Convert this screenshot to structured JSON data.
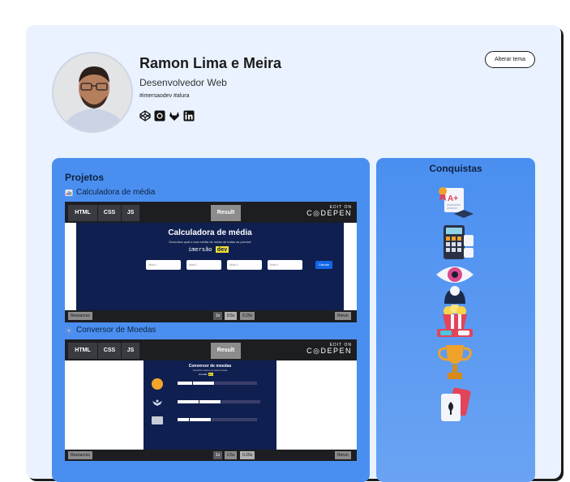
{
  "profile": {
    "name": "Ramon Lima e Meira",
    "role": "Desenvolvedor Web",
    "tags": "#imersaodev #alura",
    "social_icons": [
      "codepen-icon",
      "github-icon",
      "gitlab-icon",
      "linkedin-icon"
    ]
  },
  "theme_button": {
    "label": "Alterar tema"
  },
  "projects": {
    "title": "Projetos",
    "items": [
      {
        "label": "Calculadora de média",
        "icon": "stats-icon",
        "embed": {
          "tabs": [
            "HTML",
            "CSS",
            "JS"
          ],
          "result_tab": "Result",
          "edit_on": "EDIT ON",
          "codepen": "C◎DEPEN",
          "app_title": "Calculadora de média",
          "app_subtitle": "Descubra qual a sua média de notas de todas as provas!",
          "app_logo_text": "imersão",
          "app_logo_badge": "dev",
          "inputs": [
            "Nota 1",
            "Nota 2",
            "Nota 3",
            "Nota 4"
          ],
          "button": "Calcular",
          "footer": {
            "resources": "Resources",
            "zoom": [
              "1x",
              "0.5x",
              "0.25x"
            ],
            "rerun": "Rerun"
          }
        }
      },
      {
        "label": "Conversor de Moedas",
        "icon": "coin-icon",
        "embed": {
          "tabs": [
            "HTML",
            "CSS",
            "JS"
          ],
          "result_tab": "Result",
          "edit_on": "EDIT ON",
          "codepen": "C◎DEPEN",
          "app_title": "Conversor de moedas",
          "app_subtitle": "Transforme valores em outras moedas",
          "app_logo_text": "imersão",
          "app_logo_badge": "dev",
          "footer": {
            "resources": "Resources",
            "zoom": [
              "1x",
              "0.5x",
              "0.25x"
            ],
            "rerun": "Rerun"
          }
        }
      }
    ]
  },
  "achievements": {
    "title": "Conquistas",
    "items": [
      "certificate-icon",
      "calculator-icon",
      "eye-icon",
      "popcorn-icon",
      "trophy-icon",
      "cards-icon"
    ]
  },
  "colors": {
    "card": "#eaf2ff",
    "panel": "#4a8ff0",
    "embed_dark": "#1d1e22",
    "app_bg": "#0f2050",
    "accent_yellow": "#f3e02b"
  }
}
